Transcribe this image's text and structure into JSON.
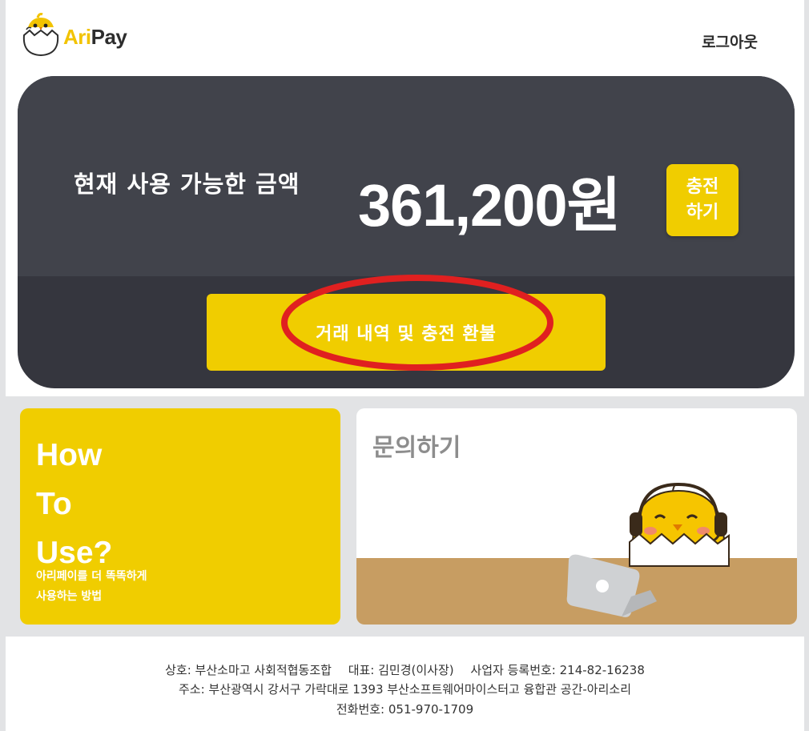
{
  "header": {
    "logo": {
      "text_ari": "Ari",
      "text_pay": "Pay",
      "icon": "chick-egg-logo-icon"
    },
    "logout_label": "로그아웃"
  },
  "balance": {
    "label": "현재 사용 가능한 금액",
    "amount": "361,200원",
    "charge_line1": "충전",
    "charge_line2": "하기",
    "history_label": "거래 내역 및 충전 환불"
  },
  "howto": {
    "title_line1": "How",
    "title_line2": "To",
    "title_line3": "Use?",
    "sub_line1": "아리페이를 더 똑똑하게",
    "sub_line2": "사용하는 방법"
  },
  "inquiry": {
    "title": "문의하기",
    "illustration": "chick-with-headset-laptop-icon"
  },
  "footer": {
    "company": "상호: 부산소마고 사회적협동조합",
    "ceo": "대표: 김민경(이사장)",
    "biz_no": "사업자 등록번호: 214-82-16238",
    "address": "주소: 부산광역시 강서구 가락대로 1393 부산소프트웨어마이스터고 융합관 공간-아리소리",
    "phone": "전화번호: 051-970-1709"
  },
  "colors": {
    "accent_yellow": "#f0cd00",
    "dark_card": "#41434b",
    "dark_card_bottom": "#35363e",
    "highlight_red": "#e02020",
    "desk_brown": "#c79d62"
  }
}
